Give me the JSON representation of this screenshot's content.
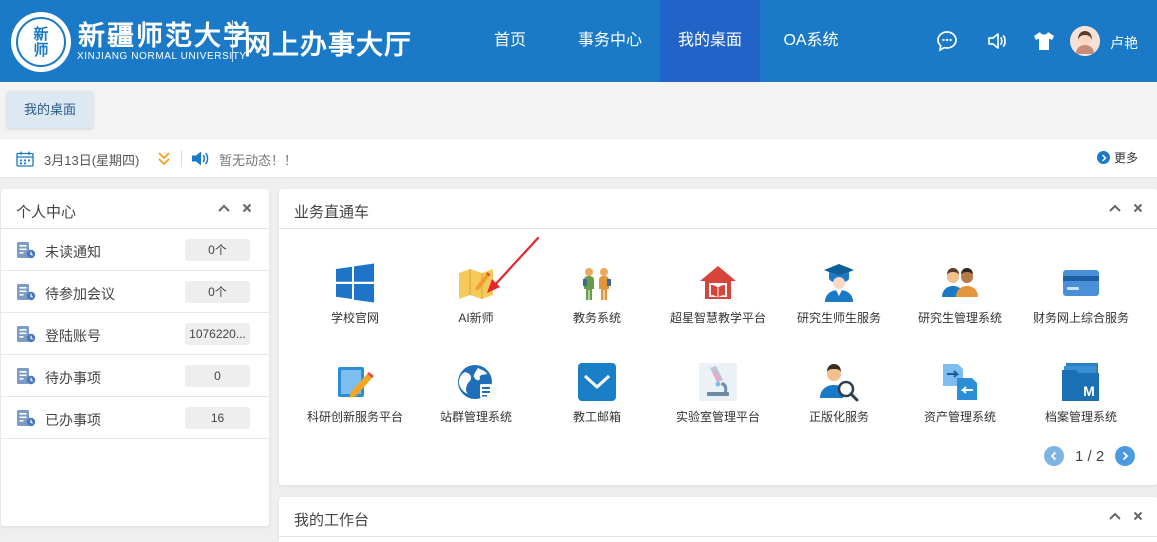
{
  "header": {
    "logo_seal_chars": [
      "新",
      "师"
    ],
    "university_name_cn": "新疆师范大学",
    "university_name_en": "XINJIANG NORMAL UNIVERSITY",
    "site_title": "网上办事大厅",
    "nav": [
      "首页",
      "事务中心",
      "我的桌面",
      "OA系统"
    ],
    "active_nav": "我的桌面",
    "icons": [
      "chat-icon",
      "speaker-icon",
      "shirt-icon"
    ],
    "username": "卢艳",
    "colors": {
      "bar": "#1a7ac7",
      "active_nav": "#2163c7"
    }
  },
  "tabs": {
    "current": "我的桌面"
  },
  "notice": {
    "date": "3月13日(星期四)",
    "message": "暂无动态！！",
    "more": "更多"
  },
  "personal_center": {
    "title": "个人中心",
    "rows": [
      {
        "label": "未读通知",
        "value": "0个"
      },
      {
        "label": "待参加会议",
        "value": "0个"
      },
      {
        "label": "登陆账号",
        "value": "1076220..."
      },
      {
        "label": "待办事项",
        "value": "0"
      },
      {
        "label": "已办事项",
        "value": "16"
      }
    ]
  },
  "business": {
    "title": "业务直通车",
    "items": [
      {
        "label": "学校官网",
        "icon": "windows-icon"
      },
      {
        "label": "AI新师",
        "icon": "map-pen-icon"
      },
      {
        "label": "教务系统",
        "icon": "students-icon"
      },
      {
        "label": "超星智慧教学平台",
        "icon": "book-house-icon"
      },
      {
        "label": "研究生师生服务",
        "icon": "graduate-icon"
      },
      {
        "label": "研究生管理系统",
        "icon": "people-icon"
      },
      {
        "label": "财务网上综合服务",
        "icon": "card-icon"
      },
      {
        "label": "科研创新服务平台",
        "icon": "edit-doc-icon"
      },
      {
        "label": "站群管理系统",
        "icon": "globe-icon"
      },
      {
        "label": "教工邮箱",
        "icon": "mail-icon"
      },
      {
        "label": "实验室管理平台",
        "icon": "microscope-icon"
      },
      {
        "label": "正版化服务",
        "icon": "user-search-icon"
      },
      {
        "label": "资产管理系统",
        "icon": "transfer-icon"
      },
      {
        "label": "档案管理系统",
        "icon": "folder-icon"
      }
    ],
    "pager": "1 / 2"
  },
  "workbench": {
    "title": "我的工作台"
  }
}
